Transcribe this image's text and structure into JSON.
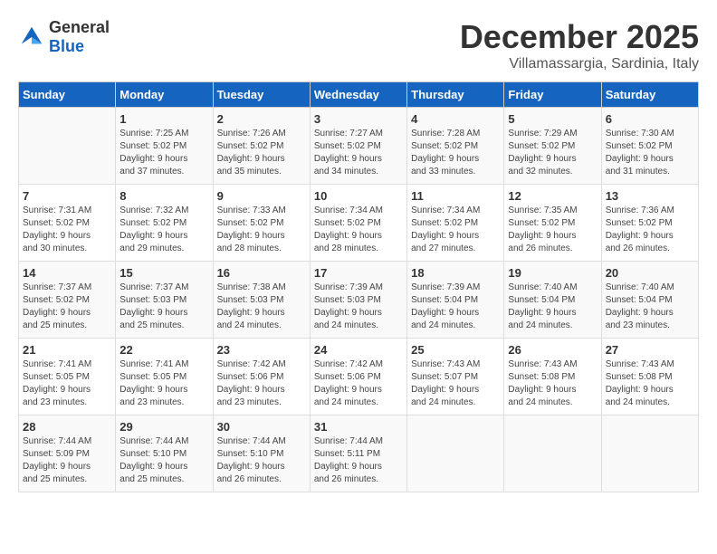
{
  "logo": {
    "text_general": "General",
    "text_blue": "Blue"
  },
  "header": {
    "month": "December 2025",
    "location": "Villamassargia, Sardinia, Italy"
  },
  "days_of_week": [
    "Sunday",
    "Monday",
    "Tuesday",
    "Wednesday",
    "Thursday",
    "Friday",
    "Saturday"
  ],
  "weeks": [
    [
      {
        "day": "",
        "info": ""
      },
      {
        "day": "1",
        "info": "Sunrise: 7:25 AM\nSunset: 5:02 PM\nDaylight: 9 hours\nand 37 minutes."
      },
      {
        "day": "2",
        "info": "Sunrise: 7:26 AM\nSunset: 5:02 PM\nDaylight: 9 hours\nand 35 minutes."
      },
      {
        "day": "3",
        "info": "Sunrise: 7:27 AM\nSunset: 5:02 PM\nDaylight: 9 hours\nand 34 minutes."
      },
      {
        "day": "4",
        "info": "Sunrise: 7:28 AM\nSunset: 5:02 PM\nDaylight: 9 hours\nand 33 minutes."
      },
      {
        "day": "5",
        "info": "Sunrise: 7:29 AM\nSunset: 5:02 PM\nDaylight: 9 hours\nand 32 minutes."
      },
      {
        "day": "6",
        "info": "Sunrise: 7:30 AM\nSunset: 5:02 PM\nDaylight: 9 hours\nand 31 minutes."
      }
    ],
    [
      {
        "day": "7",
        "info": "Sunrise: 7:31 AM\nSunset: 5:02 PM\nDaylight: 9 hours\nand 30 minutes."
      },
      {
        "day": "8",
        "info": "Sunrise: 7:32 AM\nSunset: 5:02 PM\nDaylight: 9 hours\nand 29 minutes."
      },
      {
        "day": "9",
        "info": "Sunrise: 7:33 AM\nSunset: 5:02 PM\nDaylight: 9 hours\nand 28 minutes."
      },
      {
        "day": "10",
        "info": "Sunrise: 7:34 AM\nSunset: 5:02 PM\nDaylight: 9 hours\nand 28 minutes."
      },
      {
        "day": "11",
        "info": "Sunrise: 7:34 AM\nSunset: 5:02 PM\nDaylight: 9 hours\nand 27 minutes."
      },
      {
        "day": "12",
        "info": "Sunrise: 7:35 AM\nSunset: 5:02 PM\nDaylight: 9 hours\nand 26 minutes."
      },
      {
        "day": "13",
        "info": "Sunrise: 7:36 AM\nSunset: 5:02 PM\nDaylight: 9 hours\nand 26 minutes."
      }
    ],
    [
      {
        "day": "14",
        "info": "Sunrise: 7:37 AM\nSunset: 5:02 PM\nDaylight: 9 hours\nand 25 minutes."
      },
      {
        "day": "15",
        "info": "Sunrise: 7:37 AM\nSunset: 5:03 PM\nDaylight: 9 hours\nand 25 minutes."
      },
      {
        "day": "16",
        "info": "Sunrise: 7:38 AM\nSunset: 5:03 PM\nDaylight: 9 hours\nand 24 minutes."
      },
      {
        "day": "17",
        "info": "Sunrise: 7:39 AM\nSunset: 5:03 PM\nDaylight: 9 hours\nand 24 minutes."
      },
      {
        "day": "18",
        "info": "Sunrise: 7:39 AM\nSunset: 5:04 PM\nDaylight: 9 hours\nand 24 minutes."
      },
      {
        "day": "19",
        "info": "Sunrise: 7:40 AM\nSunset: 5:04 PM\nDaylight: 9 hours\nand 24 minutes."
      },
      {
        "day": "20",
        "info": "Sunrise: 7:40 AM\nSunset: 5:04 PM\nDaylight: 9 hours\nand 23 minutes."
      }
    ],
    [
      {
        "day": "21",
        "info": "Sunrise: 7:41 AM\nSunset: 5:05 PM\nDaylight: 9 hours\nand 23 minutes."
      },
      {
        "day": "22",
        "info": "Sunrise: 7:41 AM\nSunset: 5:05 PM\nDaylight: 9 hours\nand 23 minutes."
      },
      {
        "day": "23",
        "info": "Sunrise: 7:42 AM\nSunset: 5:06 PM\nDaylight: 9 hours\nand 23 minutes."
      },
      {
        "day": "24",
        "info": "Sunrise: 7:42 AM\nSunset: 5:06 PM\nDaylight: 9 hours\nand 24 minutes."
      },
      {
        "day": "25",
        "info": "Sunrise: 7:43 AM\nSunset: 5:07 PM\nDaylight: 9 hours\nand 24 minutes."
      },
      {
        "day": "26",
        "info": "Sunrise: 7:43 AM\nSunset: 5:08 PM\nDaylight: 9 hours\nand 24 minutes."
      },
      {
        "day": "27",
        "info": "Sunrise: 7:43 AM\nSunset: 5:08 PM\nDaylight: 9 hours\nand 24 minutes."
      }
    ],
    [
      {
        "day": "28",
        "info": "Sunrise: 7:44 AM\nSunset: 5:09 PM\nDaylight: 9 hours\nand 25 minutes."
      },
      {
        "day": "29",
        "info": "Sunrise: 7:44 AM\nSunset: 5:10 PM\nDaylight: 9 hours\nand 25 minutes."
      },
      {
        "day": "30",
        "info": "Sunrise: 7:44 AM\nSunset: 5:10 PM\nDaylight: 9 hours\nand 26 minutes."
      },
      {
        "day": "31",
        "info": "Sunrise: 7:44 AM\nSunset: 5:11 PM\nDaylight: 9 hours\nand 26 minutes."
      },
      {
        "day": "",
        "info": ""
      },
      {
        "day": "",
        "info": ""
      },
      {
        "day": "",
        "info": ""
      }
    ]
  ]
}
